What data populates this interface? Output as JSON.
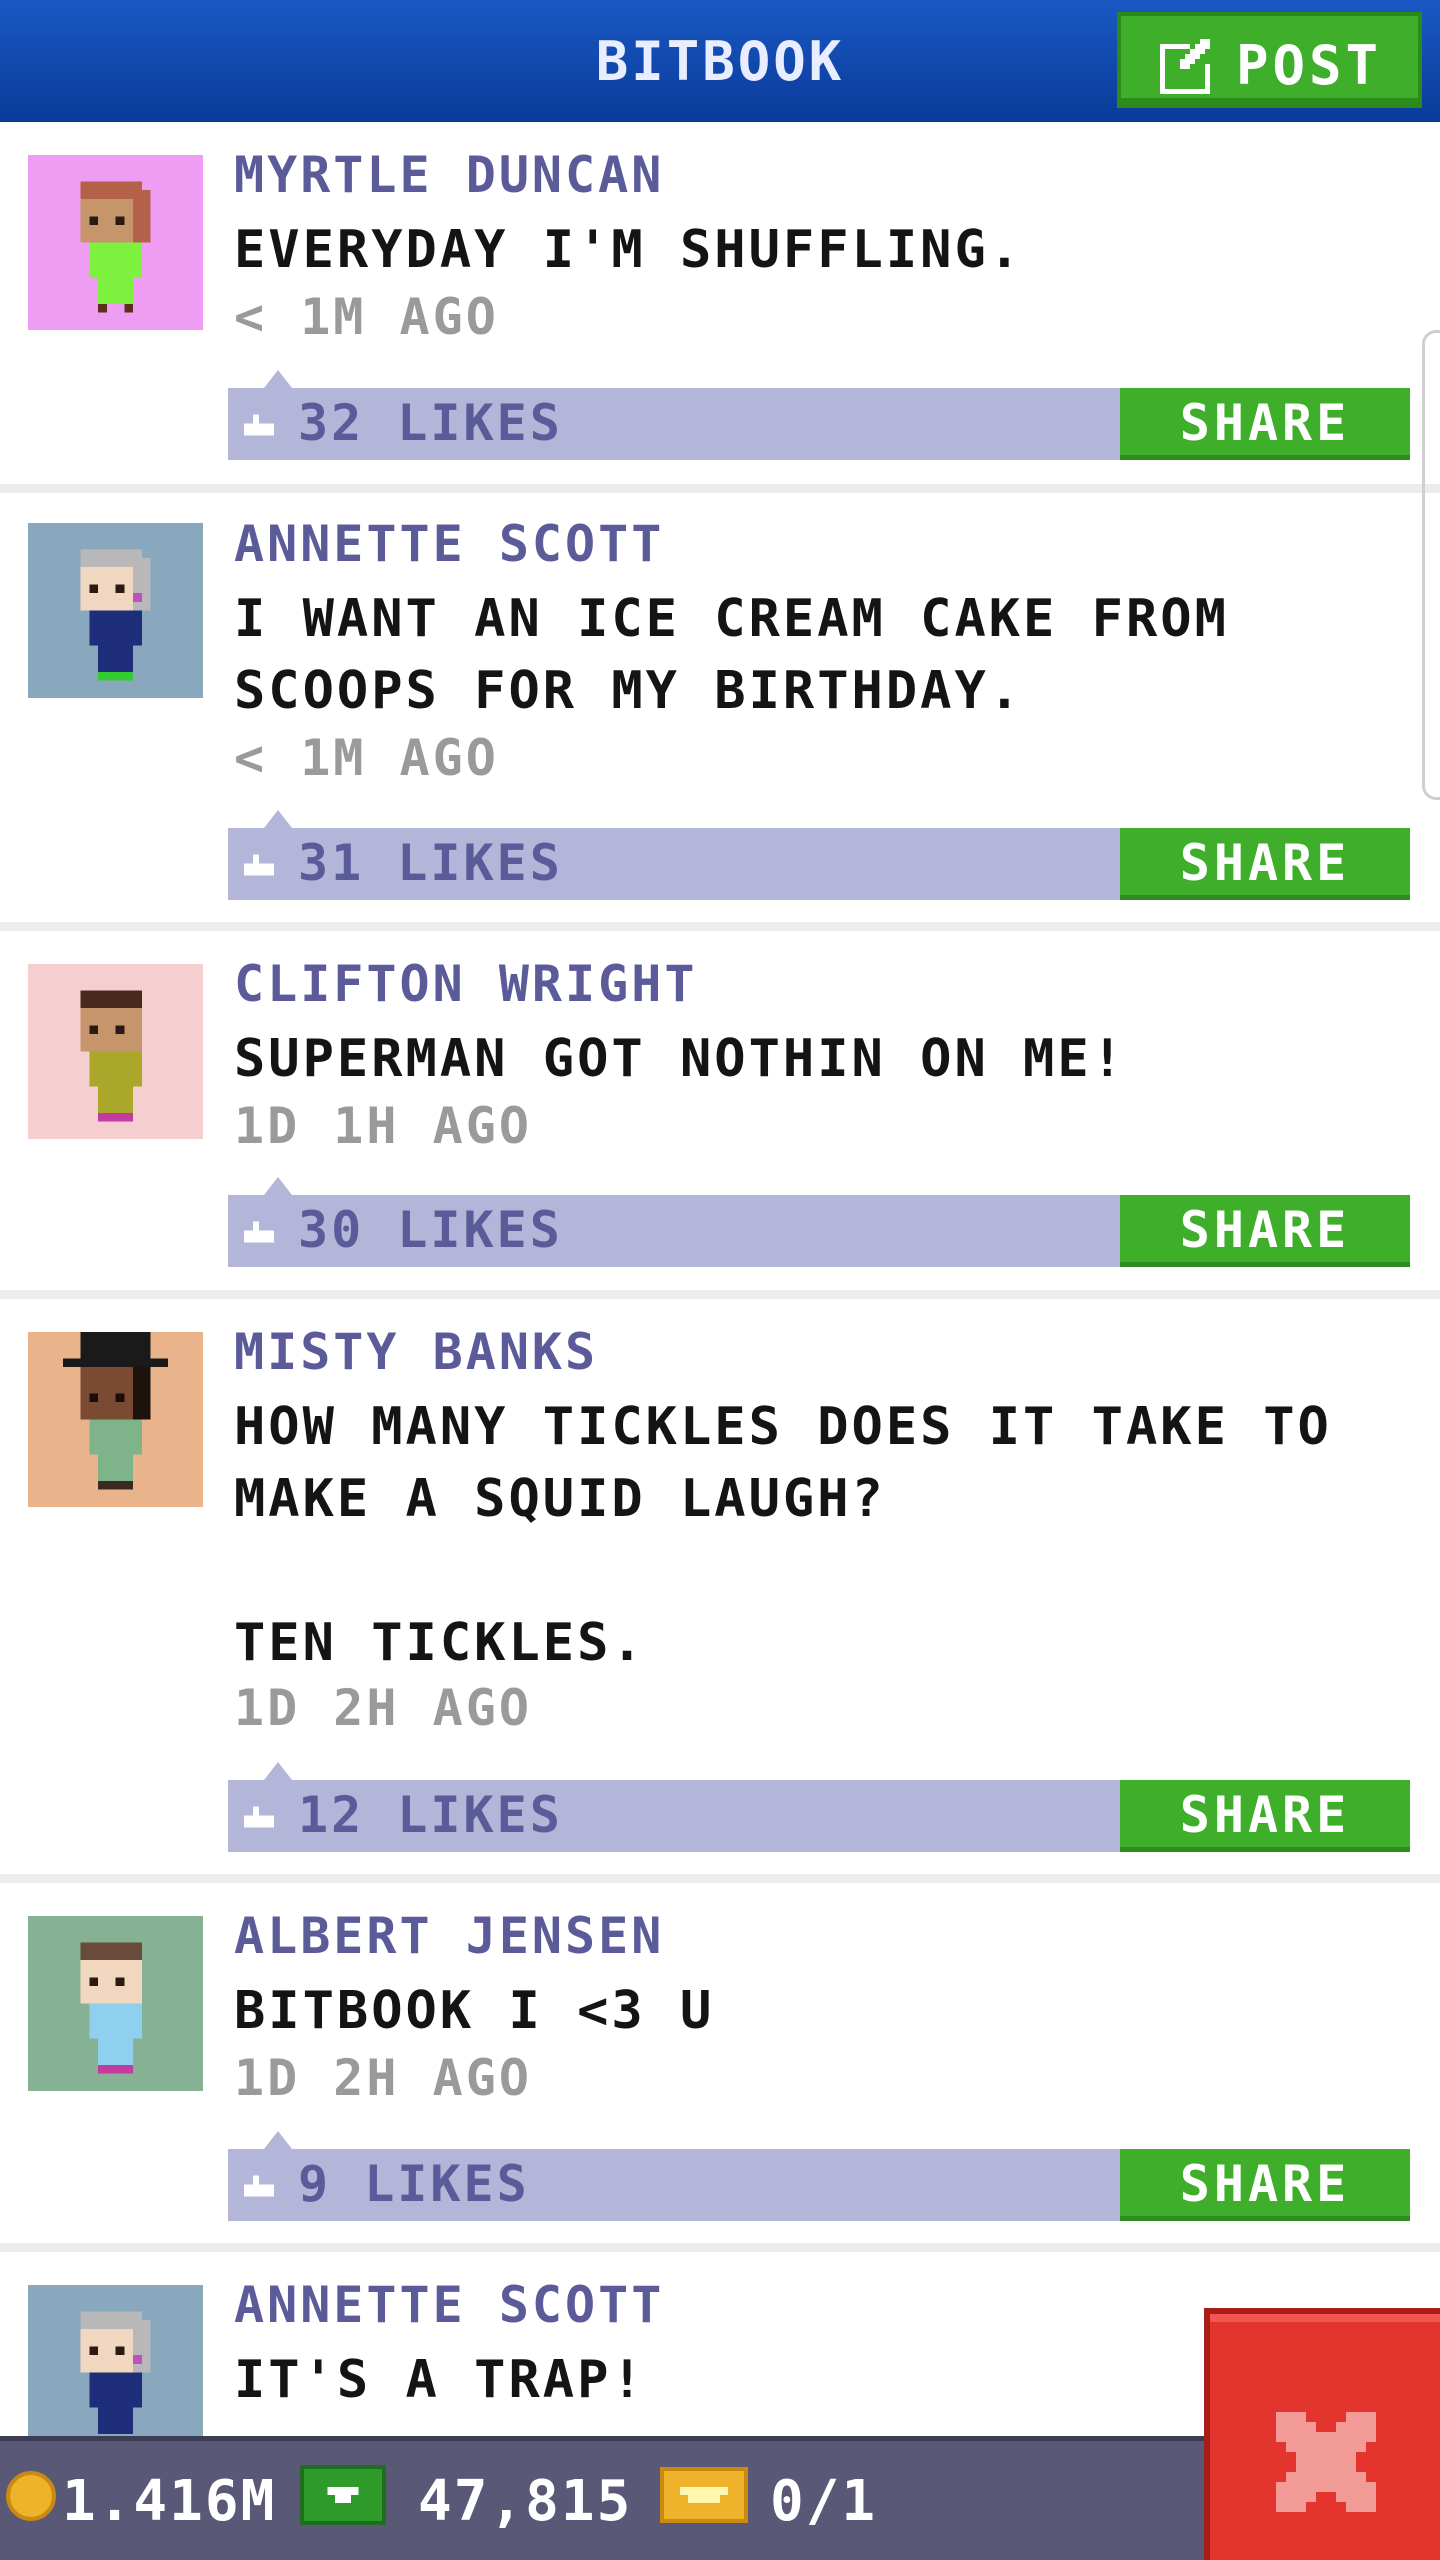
{
  "header": {
    "title": "BITBOOK",
    "post_label": "POST"
  },
  "posts": [
    {
      "author": "MYRTLE DUNCAN",
      "message": "EVERYDAY I'M SHUFFLING.",
      "time": "< 1M AGO",
      "likes": "32 LIKES",
      "share": "SHARE",
      "avatar_bg": "#ee9df2"
    },
    {
      "author": "ANNETTE SCOTT",
      "message": "I WANT AN ICE CREAM CAKE FROM\nSCOOPS FOR MY BIRTHDAY.",
      "time": "< 1M AGO",
      "likes": "31 LIKES",
      "share": "SHARE",
      "avatar_bg": "#89a7bd"
    },
    {
      "author": "CLIFTON WRIGHT",
      "message": "SUPERMAN GOT NOTHIN ON ME!",
      "time": "1D 1H AGO",
      "likes": "30 LIKES",
      "share": "SHARE",
      "avatar_bg": "#f5cfcf"
    },
    {
      "author": "MISTY BANKS",
      "message": "HOW MANY TICKLES DOES IT TAKE TO\nMAKE A SQUID LAUGH?\n\nTEN TICKLES.",
      "time": "1D 2H AGO",
      "likes": "12 LIKES",
      "share": "SHARE",
      "avatar_bg": "#e9b48c"
    },
    {
      "author": "ALBERT JENSEN",
      "message": "BITBOOK I <3 U",
      "time": "1D 2H AGO",
      "likes": "9 LIKES",
      "share": "SHARE",
      "avatar_bg": "#86b193"
    },
    {
      "author": "ANNETTE SCOTT",
      "message": "IT'S A TRAP!",
      "avatar_bg": "#89a7bd"
    }
  ],
  "status": {
    "coins": "1.416M",
    "bux": "47,815",
    "tickets": "0/1"
  },
  "icons": [
    "post-edit-icon",
    "like-icon",
    "coin-icon",
    "bux-icon",
    "ticket-icon",
    "close-icon"
  ],
  "colors": {
    "header": "#1a59c4",
    "share_green": "#3fae2a",
    "likebar": "#b3b6d8",
    "author": "#5b5b9a",
    "close_red": "#e3342d"
  }
}
